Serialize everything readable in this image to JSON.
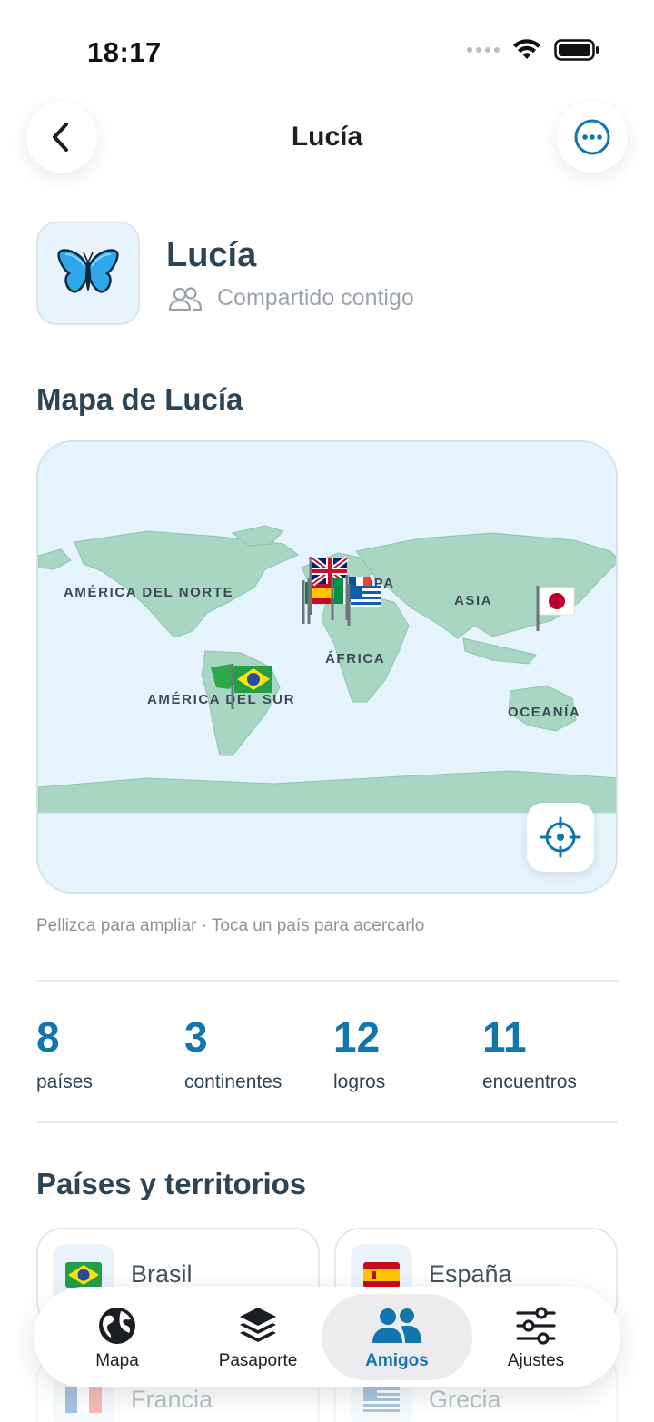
{
  "status": {
    "time": "18:17"
  },
  "nav": {
    "title": "Lucía"
  },
  "profile": {
    "name": "Lucía",
    "shared_text": "Compartido contigo"
  },
  "map_section": {
    "title": "Mapa de Lucía",
    "hint": "Pellizca para ampliar · Toca un país para acercarlo",
    "labels": {
      "north_america": "AMÉRICA DEL NORTE",
      "europe": "EUROPA",
      "asia": "ASIA",
      "africa": "ÁFRICA",
      "south_america": "AMÉRICA DEL SUR",
      "oceania": "OCEANÍA"
    }
  },
  "stats": [
    {
      "value": "8",
      "label": "países"
    },
    {
      "value": "3",
      "label": "continentes"
    },
    {
      "value": "12",
      "label": "logros"
    },
    {
      "value": "11",
      "label": "encuentros"
    }
  ],
  "countries_section": {
    "title": "Países y territorios",
    "items": [
      {
        "name": "Brasil",
        "flag": "brazil-flag"
      },
      {
        "name": "España",
        "flag": "spain-flag"
      },
      {
        "name": "Francia",
        "flag": "france-flag"
      },
      {
        "name": "Grecia",
        "flag": "greece-flag"
      }
    ]
  },
  "tabs": [
    {
      "label": "Mapa",
      "icon": "globe-icon"
    },
    {
      "label": "Pasaporte",
      "icon": "layers-icon"
    },
    {
      "label": "Amigos",
      "icon": "people-icon",
      "active": true
    },
    {
      "label": "Ajustes",
      "icon": "sliders-icon"
    }
  ],
  "colors": {
    "accent": "#1275ad",
    "land": "#a9d6c2",
    "ocean": "#e5f3fd"
  }
}
